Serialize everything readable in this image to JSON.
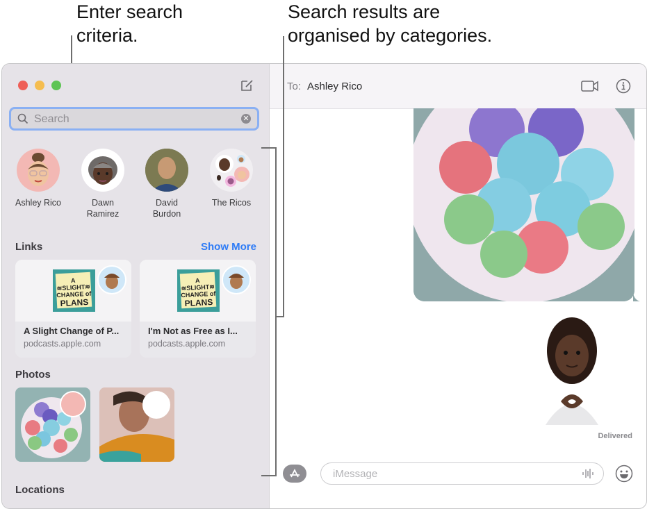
{
  "callouts": {
    "left": [
      "Enter search",
      "criteria."
    ],
    "right": [
      "Search results are",
      "organised by categories."
    ]
  },
  "sidebar": {
    "search": {
      "placeholder": "Search",
      "icon": "magnifier-icon",
      "clear_icon": "clear-icon"
    },
    "contacts": [
      {
        "name_lines": [
          "Ashley Rico"
        ],
        "bg": "#f3b8b4"
      },
      {
        "name_lines": [
          "Dawn",
          "Ramirez"
        ],
        "bg": "#ffffff"
      },
      {
        "name_lines": [
          "David",
          "Burdon"
        ],
        "bg": "#4a6a48"
      },
      {
        "name_lines": [
          "The Ricos"
        ],
        "bg": "#f1eff2"
      }
    ],
    "links_section": {
      "title": "Links",
      "show_more": "Show More",
      "items": [
        {
          "title": "A Slight Change of P...",
          "url": "podcasts.apple.com",
          "art_text": [
            "A ≋SLIGHT≋",
            "CHANGE of",
            "PLANS"
          ]
        },
        {
          "title": "I'm Not as Free as I...",
          "url": "podcasts.apple.com",
          "art_text": [
            "A ≋SLIGHT≋",
            "CHANGE of",
            "PLANS"
          ]
        }
      ]
    },
    "photos_section": {
      "title": "Photos"
    },
    "locations_section": {
      "title": "Locations"
    }
  },
  "conversation": {
    "to_label": "To:",
    "recipient": "Ashley Rico",
    "status": "Delivered",
    "input_placeholder": "iMessage"
  },
  "colors": {
    "accent": "#2f7cf6",
    "search_focus": "#8ab0f3",
    "close": "#ee5f57",
    "minimize": "#f5bd4f",
    "zoom": "#5ec454"
  }
}
